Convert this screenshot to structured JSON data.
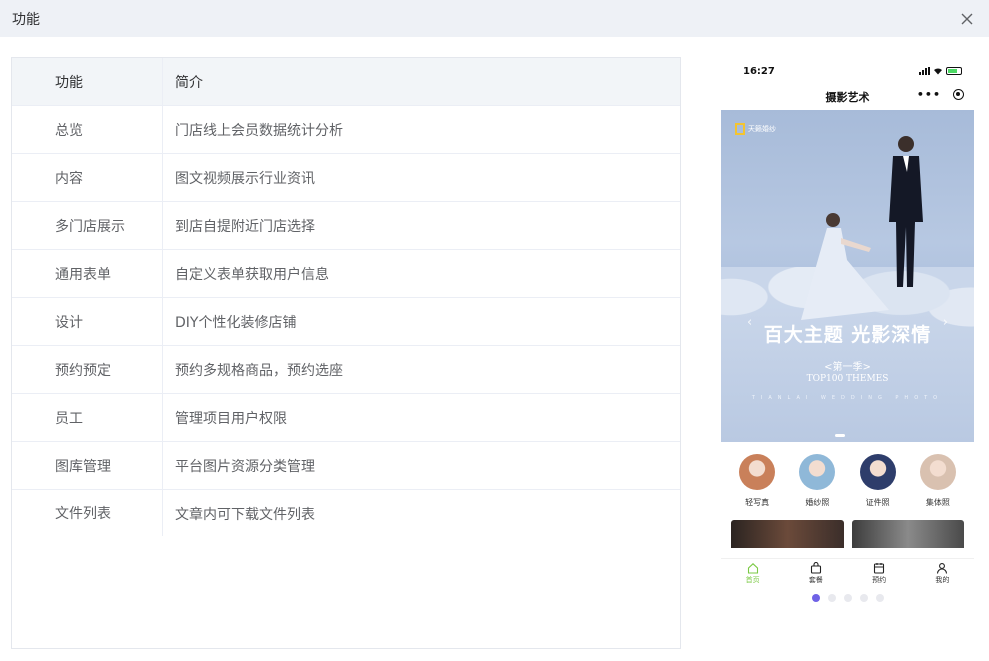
{
  "dialog": {
    "title": "功能"
  },
  "table": {
    "headers": [
      "功能",
      "简介"
    ],
    "rows": [
      [
        "总览",
        "门店线上会员数据统计分析"
      ],
      [
        "内容",
        "图文视频展示行业资讯"
      ],
      [
        "多门店展示",
        "到店自提附近门店选择"
      ],
      [
        "通用表单",
        "自定义表单获取用户信息"
      ],
      [
        "设计",
        "DIY个性化装修店铺"
      ],
      [
        "预约预定",
        "预约多规格商品，预约选座"
      ],
      [
        "员工",
        "管理项目用户权限"
      ],
      [
        "图库管理",
        "平台图片资源分类管理"
      ],
      [
        "文件列表",
        "文章内可下载文件列表"
      ]
    ]
  },
  "phone": {
    "time": "16:27",
    "nav_title": "摄影艺术",
    "more_label": "•••",
    "banner": {
      "logo_text": "天籁婚纱",
      "title": "百大主题 光影深情",
      "subtitle": "<第一季>",
      "subtitle2": "TOP100 THEMES",
      "tagline": "TIANLAI WEDDING PHOTO"
    },
    "categories": [
      {
        "label": "轻写真",
        "color": "#c9805a"
      },
      {
        "label": "婚纱照",
        "color": "#8fb8d8"
      },
      {
        "label": "证件照",
        "color": "#2e3d6b"
      },
      {
        "label": "集体照",
        "color": "#d9c1b0"
      }
    ],
    "tabs": [
      {
        "label": "首页",
        "active": true
      },
      {
        "label": "套餐",
        "active": false
      },
      {
        "label": "预约",
        "active": false
      },
      {
        "label": "我的",
        "active": false
      }
    ],
    "page_count": 5,
    "active_page": 1,
    "accent_color": "#6f62e6",
    "tab_active_color": "#7ac943"
  }
}
